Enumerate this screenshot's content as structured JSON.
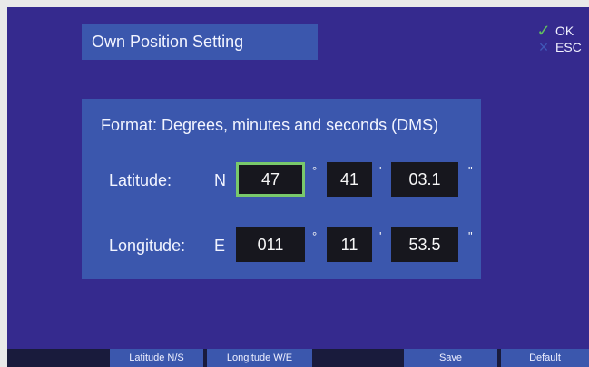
{
  "title": "Own Position Setting",
  "actions": {
    "ok_label": "OK",
    "esc_label": "ESC",
    "ok_icon": "check-icon",
    "esc_icon": "close-icon"
  },
  "format": {
    "label": "Format: Degrees, minutes and seconds (DMS)"
  },
  "latitude": {
    "label": "Latitude:",
    "hemisphere": "N",
    "degrees": "47",
    "minutes": "41",
    "seconds": "03.1",
    "degree_symbol": "°",
    "minute_symbol": "'",
    "second_symbol": "\""
  },
  "longitude": {
    "label": "Longitude:",
    "hemisphere": "E",
    "degrees": "011",
    "minutes": "11",
    "seconds": "53.5",
    "degree_symbol": "°",
    "minute_symbol": "'",
    "second_symbol": "\""
  },
  "bottom_buttons": {
    "latitude_ns": "Latitude N/S",
    "longitude_we": "Longitude W/E",
    "save": "Save",
    "default": "Default"
  },
  "colors": {
    "screen_background": "#352a8e",
    "panel_background": "#3b57ad",
    "field_background": "#17171e",
    "active_border": "#79c96b",
    "ok_check": "#63c25e",
    "esc_x": "#4059b8",
    "bottom_bar": "#191b3c",
    "text": "#f2f4ff"
  }
}
